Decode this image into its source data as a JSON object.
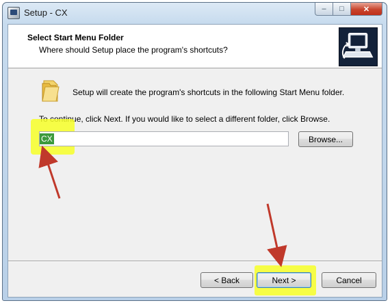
{
  "window": {
    "title": "Setup - CX",
    "minimize_glyph": "–",
    "maximize_glyph": "□",
    "close_glyph": "✕"
  },
  "header": {
    "title": "Select Start Menu Folder",
    "subtitle": "Where should Setup place the program's shortcuts?"
  },
  "body": {
    "intro": "Setup will create the program's shortcuts in the following Start Menu folder.",
    "instruction": "To continue, click Next. If you would like to select a different folder, click Browse.",
    "folder_value": "CX"
  },
  "buttons": {
    "browse": "Browse...",
    "back": "< Back",
    "next": "Next >",
    "cancel": "Cancel"
  },
  "icons": {
    "app": "setup-icon",
    "folder": "folder-icon",
    "header_image": "computer-install-icon"
  },
  "colors": {
    "highlight": "#f7ff28",
    "annotation_arrow": "#c0392b",
    "selection": "#3c9a3c"
  }
}
